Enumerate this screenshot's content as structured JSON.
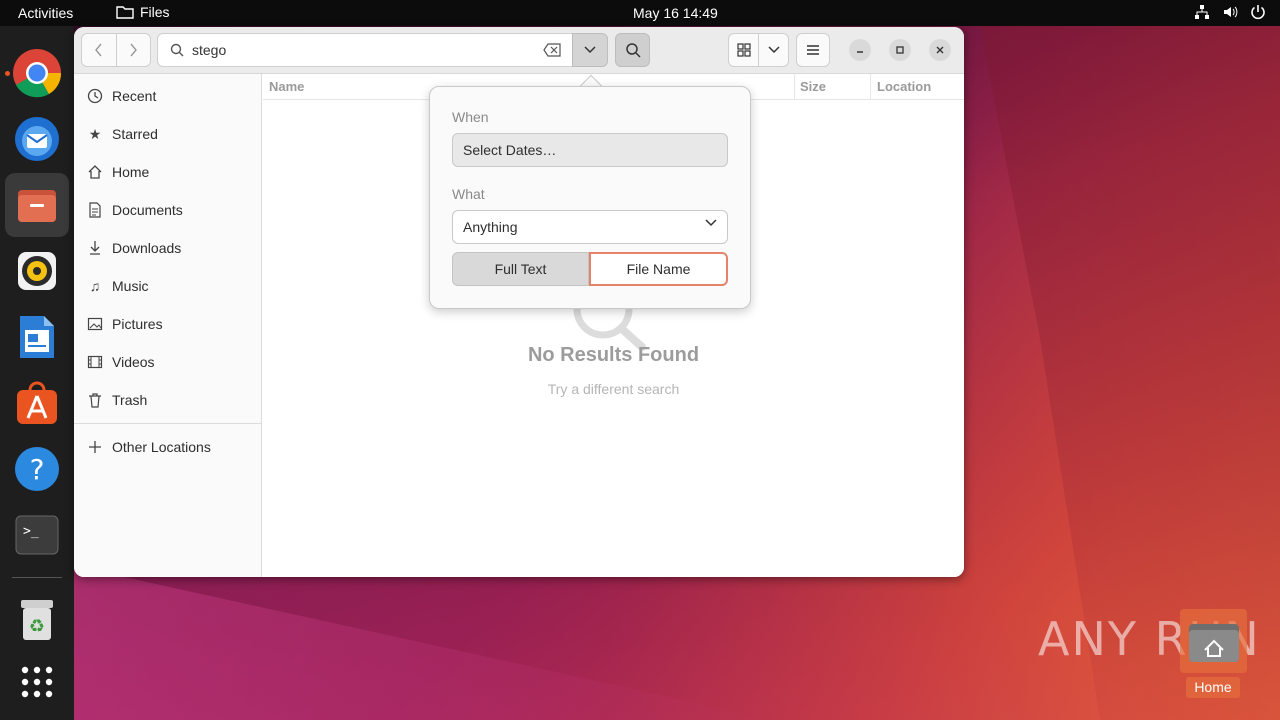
{
  "topbar": {
    "activities": "Activities",
    "app_name": "Files",
    "clock": "May 16  14:49"
  },
  "dock": {
    "items": [
      "chrome-icon",
      "thunderbird-icon",
      "files-icon",
      "rhythmbox-icon",
      "libreoffice-writer-icon",
      "app-center-icon",
      "help-icon",
      "terminal-icon",
      "trash-icon",
      "show-apps-icon"
    ]
  },
  "window": {
    "search": {
      "value": "stego"
    },
    "columns": {
      "name": "Name",
      "size": "Size",
      "location": "Location"
    },
    "sidebar": {
      "items": [
        {
          "label": "Recent",
          "icon": "clock-icon"
        },
        {
          "label": "Starred",
          "icon": "star-icon"
        },
        {
          "label": "Home",
          "icon": "home-icon"
        },
        {
          "label": "Documents",
          "icon": "document-icon"
        },
        {
          "label": "Downloads",
          "icon": "download-icon"
        },
        {
          "label": "Music",
          "icon": "music-icon"
        },
        {
          "label": "Pictures",
          "icon": "picture-icon"
        },
        {
          "label": "Videos",
          "icon": "video-icon"
        },
        {
          "label": "Trash",
          "icon": "trash-icon"
        }
      ],
      "other_locations": "Other Locations"
    },
    "empty_state": {
      "title": "No Results Found",
      "subtitle": "Try a different search"
    },
    "popover": {
      "when_label": "When",
      "date_button": "Select Dates…",
      "what_label": "What",
      "what_value": "Anything",
      "full_text": "Full Text",
      "file_name": "File Name"
    }
  },
  "desktop": {
    "watermark": "ANY RUN",
    "home_label": "Home"
  },
  "colors": {
    "accent": "#e95420",
    "selected_border": "#e4826a"
  }
}
